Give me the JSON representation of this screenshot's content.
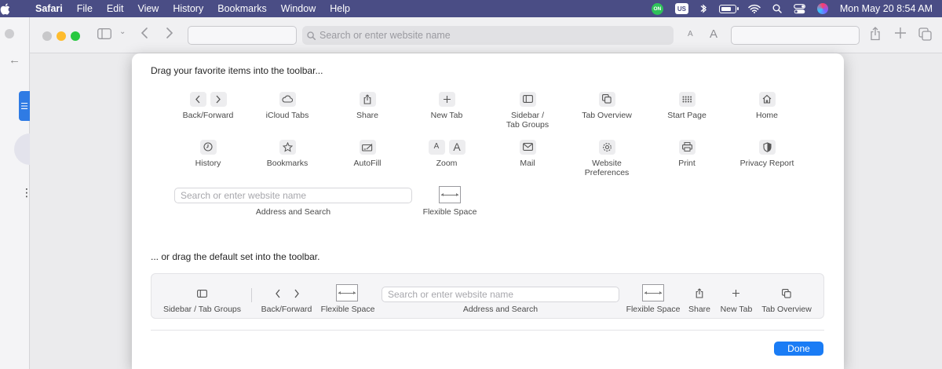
{
  "menubar": {
    "app": "Safari",
    "items": [
      "File",
      "Edit",
      "View",
      "History",
      "Bookmarks",
      "Window",
      "Help"
    ],
    "vpn_label": "ON",
    "keyboard": "US",
    "clock": "Mon May 20  8:54 AM"
  },
  "toolbar": {
    "search_placeholder": "Search or enter website name"
  },
  "sheet": {
    "heading_favorites": "Drag your favorite items into the toolbar...",
    "heading_default": "... or drag the default set into the toolbar.",
    "items": {
      "back_forward": "Back/Forward",
      "icloud_tabs": "iCloud Tabs",
      "share": "Share",
      "new_tab": "New Tab",
      "sidebar_tab_groups_line1": "Sidebar /",
      "sidebar_tab_groups_line2": "Tab Groups",
      "tab_overview": "Tab Overview",
      "start_page": "Start Page",
      "home": "Home",
      "history": "History",
      "bookmarks": "Bookmarks",
      "autofill": "AutoFill",
      "zoom": "Zoom",
      "mail": "Mail",
      "website_prefs_line1": "Website",
      "website_prefs_line2": "Preferences",
      "print": "Print",
      "privacy_report": "Privacy Report",
      "address_placeholder": "Search or enter website name",
      "address_and_search": "Address and Search",
      "flexible_space": "Flexible Space"
    },
    "default_set": {
      "sidebar": "Sidebar / Tab Groups",
      "back_forward": "Back/Forward",
      "flexible_space_1": "Flexible Space",
      "address_placeholder": "Search or enter website name",
      "address_and_search": "Address and Search",
      "flexible_space_2": "Flexible Space",
      "share": "Share",
      "new_tab": "New Tab",
      "tab_overview": "Tab Overview"
    },
    "done_label": "Done"
  },
  "colors": {
    "menubar": "#4a4d85",
    "accent": "#1a7cf5"
  }
}
